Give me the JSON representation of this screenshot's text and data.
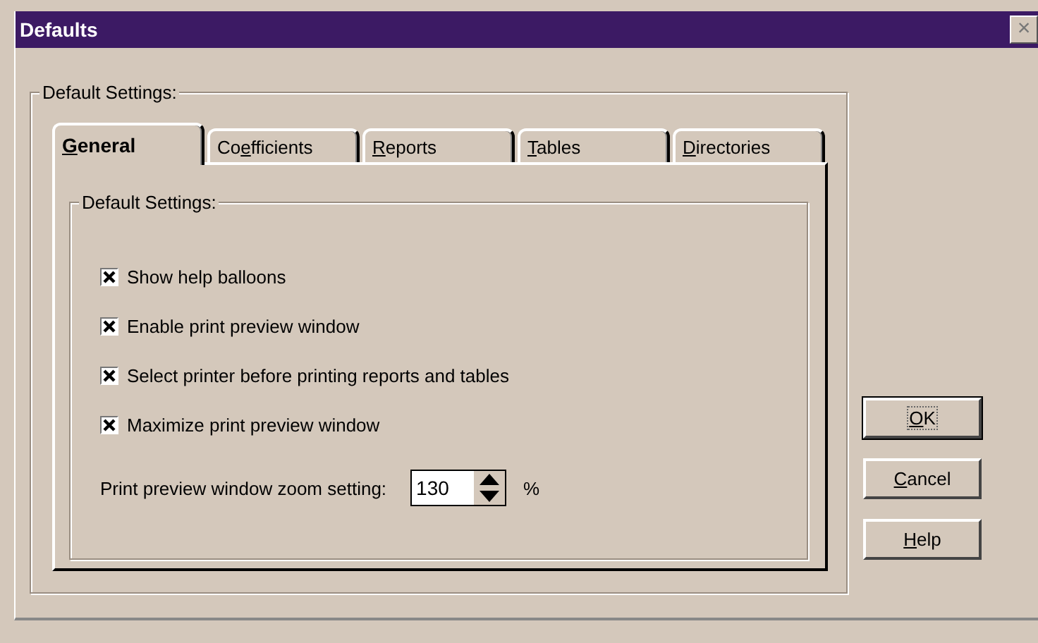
{
  "window": {
    "title": "Defaults",
    "close": "×"
  },
  "group": {
    "label": "Default Settings:"
  },
  "tabs": [
    {
      "label": {
        "key": "G",
        "after": "eneral"
      },
      "selected": true
    },
    {
      "label": {
        "before": "Co",
        "key": "e",
        "after": "fficients"
      },
      "selected": false
    },
    {
      "label": {
        "key": "R",
        "after": "eports"
      },
      "selected": false
    },
    {
      "label": {
        "key": "T",
        "after": "ables"
      },
      "selected": false
    },
    {
      "label": {
        "key": "D",
        "after": "irectories"
      },
      "selected": false
    }
  ],
  "panel": {
    "label": "Default Settings:",
    "options": [
      {
        "label": "Show help balloons",
        "checked": true
      },
      {
        "label": "Enable print preview window",
        "checked": true
      },
      {
        "label": "Select printer before printing reports and tables",
        "checked": true
      },
      {
        "label": "Maximize print preview window",
        "checked": true
      }
    ],
    "zoom": {
      "label": "Print preview window zoom setting:",
      "value": "130",
      "unit": "%"
    }
  },
  "buttons": [
    {
      "label": {
        "key": "O",
        "after": "K"
      },
      "default": true
    },
    {
      "label": {
        "key": "C",
        "after": "ancel"
      },
      "default": false
    },
    {
      "label": {
        "key": "H",
        "after": "elp"
      },
      "default": false
    }
  ]
}
